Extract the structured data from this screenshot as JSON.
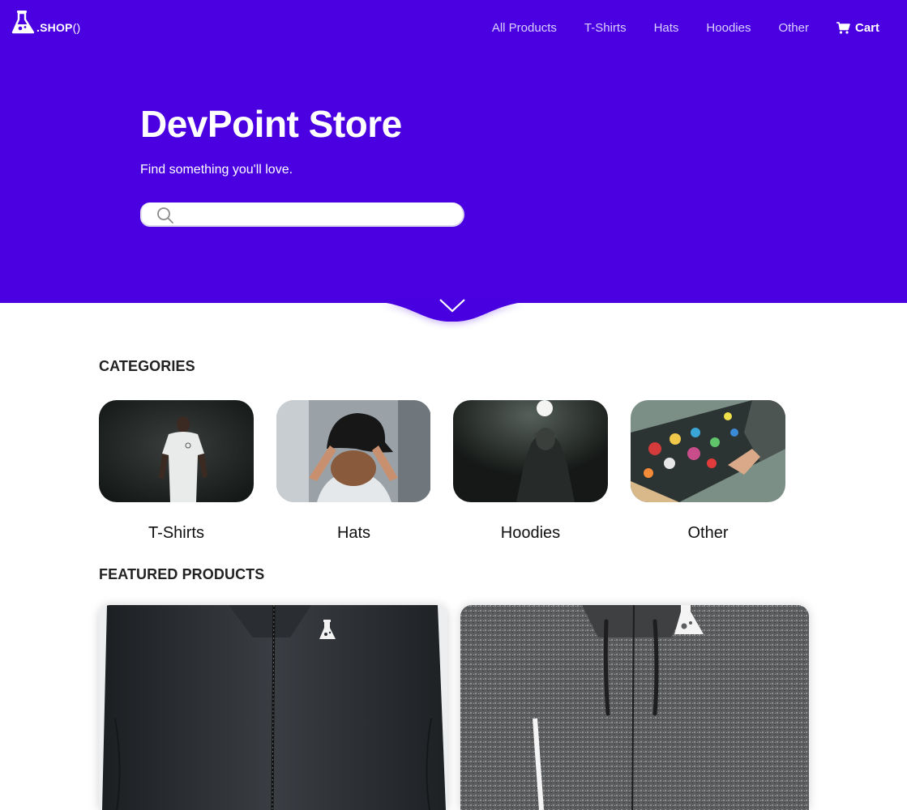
{
  "header": {
    "logo_text": ".SHOP",
    "logo_parens": "()",
    "nav": [
      {
        "label": "All Products"
      },
      {
        "label": "T-Shirts"
      },
      {
        "label": "Hats"
      },
      {
        "label": "Hoodies"
      },
      {
        "label": "Other"
      }
    ],
    "cart_label": "Cart"
  },
  "hero": {
    "title": "DevPoint Store",
    "subtitle": "Find something you'll love.",
    "search_value": "",
    "search_placeholder": ""
  },
  "categories": {
    "heading": "CATEGORIES",
    "items": [
      {
        "label": "T-Shirts"
      },
      {
        "label": "Hats"
      },
      {
        "label": "Hoodies"
      },
      {
        "label": "Other"
      }
    ]
  },
  "featured": {
    "heading": "FEATURED PRODUCTS"
  },
  "colors": {
    "brand": "#4a00e0",
    "nav_text": "#d9d2ff",
    "text": "#111111"
  },
  "icons": {
    "logo": "flask-icon",
    "cart": "cart-icon",
    "search": "search-icon",
    "scroll": "chevron-down-icon"
  }
}
